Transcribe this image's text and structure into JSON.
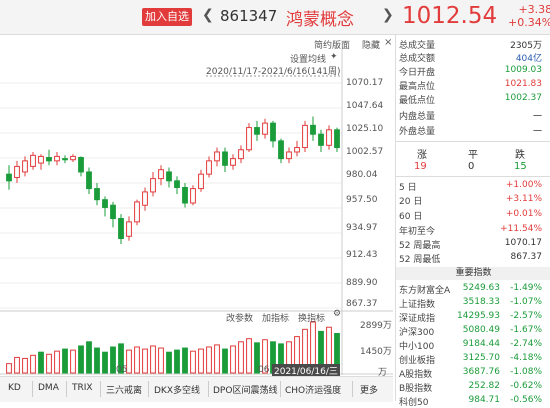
{
  "header": {
    "add_favorite": "加入自选",
    "prev_icon": "chevron-left",
    "next_icon": "chevron-right",
    "code": "861347",
    "name": "鸿蒙概念",
    "price": "1012.54",
    "change": "+3.38",
    "change_pct": "+0.34%"
  },
  "chart_toolbar": {
    "layout": "简约版面",
    "hide": "隐藏",
    "settings_ma": "设置均线",
    "date_range": "2020/11/17-2021/6/16(141周)",
    "pin_icon": "pin",
    "close_icon": "close"
  },
  "price_axis": [
    "1070.17",
    "1047.64",
    "1025.10",
    "1002.57",
    "980.04",
    "957.50",
    "934.97",
    "912.43",
    "889.90",
    "867.37"
  ],
  "volume_axis": [
    "2899万",
    "1450万",
    "万"
  ],
  "volume_toolbar": {
    "change_params": "改参数",
    "add_indicator": "加指标",
    "swap_indicator": "换指标"
  },
  "x_axis": {
    "label1": "05",
    "label2": "06",
    "cursor_date": "2021/06/16/三"
  },
  "colors": {
    "up": "#e23b3b",
    "down": "#1a9c3a",
    "accent": "#e23b3b"
  },
  "chart_data": {
    "type": "candlestick",
    "title": "",
    "ylim": [
      867.37,
      1070.17
    ],
    "candles": [
      [
        988,
        982,
        996,
        974
      ],
      [
        985,
        995,
        1000,
        980
      ],
      [
        990,
        1000,
        1004,
        986
      ],
      [
        995,
        1005,
        1008,
        992
      ],
      [
        998,
        1004,
        1006,
        992
      ],
      [
        1003,
        1000,
        1010,
        996
      ],
      [
        1000,
        1004,
        1008,
        996
      ],
      [
        1002,
        1001,
        1005,
        998
      ],
      [
        1001,
        1004,
        1006,
        999
      ],
      [
        1003,
        990,
        1004,
        986
      ],
      [
        990,
        975,
        994,
        970
      ],
      [
        975,
        965,
        980,
        960
      ],
      [
        965,
        958,
        968,
        950
      ],
      [
        960,
        948,
        963,
        940
      ],
      [
        948,
        930,
        952,
        925
      ],
      [
        932,
        945,
        950,
        928
      ],
      [
        945,
        963,
        965,
        942
      ],
      [
        960,
        972,
        976,
        955
      ],
      [
        972,
        984,
        990,
        968
      ],
      [
        984,
        992,
        996,
        978
      ],
      [
        990,
        982,
        994,
        976
      ],
      [
        982,
        976,
        986,
        970
      ],
      [
        976,
        962,
        980,
        958
      ],
      [
        962,
        975,
        978,
        960
      ],
      [
        975,
        988,
        992,
        972
      ],
      [
        988,
        1000,
        1004,
        985
      ],
      [
        1000,
        1008,
        1012,
        995
      ],
      [
        1008,
        996,
        1012,
        990
      ],
      [
        996,
        1002,
        1006,
        992
      ],
      [
        1002,
        1010,
        1014,
        998
      ],
      [
        1010,
        1030,
        1034,
        1008
      ],
      [
        1030,
        1024,
        1036,
        1018
      ],
      [
        1024,
        1034,
        1038,
        1020
      ],
      [
        1034,
        1018,
        1036,
        1012
      ],
      [
        1018,
        1002,
        1020,
        998
      ],
      [
        1002,
        1008,
        1012,
        998
      ],
      [
        1008,
        1012,
        1018,
        1004
      ],
      [
        1012,
        1032,
        1036,
        1008
      ],
      [
        1032,
        1024,
        1040,
        1018
      ],
      [
        1024,
        1014,
        1028,
        1008
      ],
      [
        1014,
        1028,
        1032,
        1010
      ],
      [
        1028,
        1012,
        1030,
        1008
      ]
    ],
    "volumes": [
      [
        0.18,
        1
      ],
      [
        0.3,
        1
      ],
      [
        0.28,
        1
      ],
      [
        0.34,
        1
      ],
      [
        0.4,
        -1
      ],
      [
        0.36,
        1
      ],
      [
        0.42,
        1
      ],
      [
        0.46,
        -1
      ],
      [
        0.44,
        1
      ],
      [
        0.52,
        -1
      ],
      [
        0.6,
        -1
      ],
      [
        0.48,
        -1
      ],
      [
        0.4,
        -1
      ],
      [
        0.5,
        -1
      ],
      [
        0.56,
        -1
      ],
      [
        0.44,
        1
      ],
      [
        0.5,
        1
      ],
      [
        0.46,
        1
      ],
      [
        0.52,
        1
      ],
      [
        0.48,
        1
      ],
      [
        0.4,
        -1
      ],
      [
        0.44,
        -1
      ],
      [
        0.48,
        -1
      ],
      [
        0.42,
        1
      ],
      [
        0.46,
        1
      ],
      [
        0.5,
        1
      ],
      [
        0.54,
        1
      ],
      [
        0.46,
        -1
      ],
      [
        0.52,
        1
      ],
      [
        0.6,
        1
      ],
      [
        0.66,
        1
      ],
      [
        0.58,
        -1
      ],
      [
        0.64,
        1
      ],
      [
        0.6,
        -1
      ],
      [
        0.56,
        -1
      ],
      [
        0.6,
        1
      ],
      [
        0.7,
        1
      ],
      [
        0.84,
        1
      ],
      [
        0.98,
        1
      ],
      [
        0.8,
        -1
      ],
      [
        0.88,
        1
      ],
      [
        0.76,
        -1
      ]
    ]
  },
  "summary": [
    {
      "k": "总成交量",
      "v": "2305万",
      "c": "dark"
    },
    {
      "k": "总成交额",
      "v": "404亿",
      "c": "blue"
    },
    {
      "k": "今日开盘",
      "v": "1009.03",
      "c": "green"
    },
    {
      "k": "最高点位",
      "v": "1021.83",
      "c": "red"
    },
    {
      "k": "最低点位",
      "v": "1002.37",
      "c": "green"
    },
    {
      "k": "内盘总量",
      "v": "一",
      "c": "dark"
    },
    {
      "k": "外盘总量",
      "v": "一",
      "c": "dark"
    }
  ],
  "updown": {
    "labels": [
      "涨",
      "平",
      "跌"
    ],
    "values": [
      "19",
      "0",
      "15"
    ]
  },
  "periods": [
    {
      "k": "5 日",
      "v": "+1.00%",
      "c": "red"
    },
    {
      "k": "20 日",
      "v": "+3.11%",
      "c": "red"
    },
    {
      "k": "60 日",
      "v": "+0.01%",
      "c": "red"
    },
    {
      "k": "年初至今",
      "v": "+11.54%",
      "c": "red"
    },
    {
      "k": "52 周最高",
      "v": "1070.17",
      "c": "dark"
    },
    {
      "k": "52 周最低",
      "v": "867.37",
      "c": "dark"
    }
  ],
  "indices_header": "重要指数",
  "indices": [
    {
      "name": "东方财富全A",
      "price": "5249.63",
      "pct": "-1.49%"
    },
    {
      "name": "上证指数",
      "price": "3518.33",
      "pct": "-1.07%"
    },
    {
      "name": "深证成指",
      "price": "14295.93",
      "pct": "-2.57%"
    },
    {
      "name": "沪深300",
      "price": "5080.49",
      "pct": "-1.67%"
    },
    {
      "name": "中小100",
      "price": "9184.44",
      "pct": "-2.74%"
    },
    {
      "name": "创业板指",
      "price": "3125.70",
      "pct": "-4.18%"
    },
    {
      "name": "A股指数",
      "price": "3687.76",
      "pct": "-1.08%"
    },
    {
      "name": "B股指数",
      "price": "252.82",
      "pct": "-0.62%"
    },
    {
      "name": "科创50",
      "price": "984.71",
      "pct": "-0.56%"
    }
  ],
  "tabs": [
    "KD",
    "DMA",
    "TRIX",
    "三六戒离",
    "DKX多空线",
    "DPO区间震荡线",
    "CHO济运强度",
    "更多"
  ]
}
